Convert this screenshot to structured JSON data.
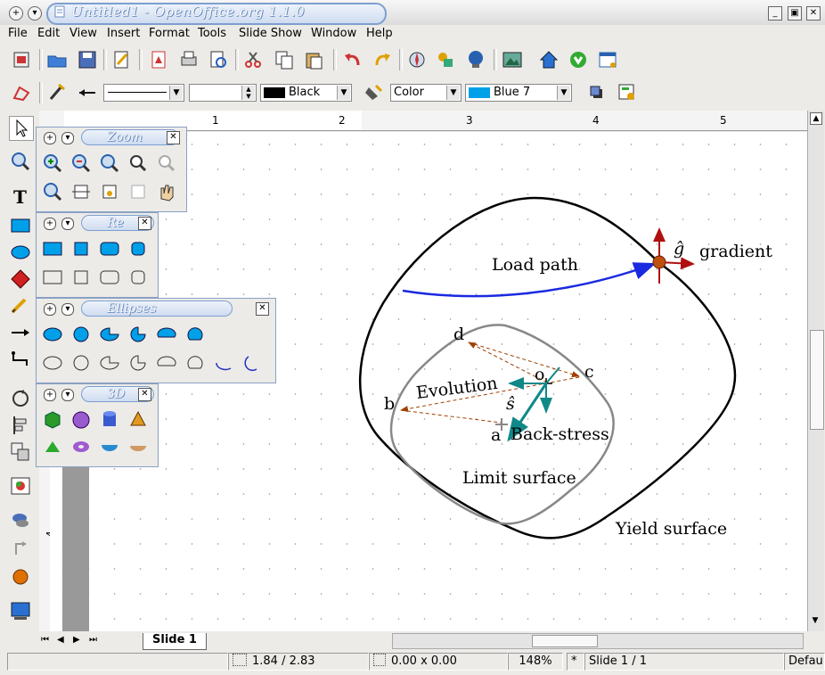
{
  "window": {
    "title": "Untitled1 - OpenOffice.org 1.1.0"
  },
  "menu": [
    "File",
    "Edit",
    "View",
    "Insert",
    "Format",
    "Tools",
    "Slide Show",
    "Window",
    "Help"
  ],
  "line_toolbar": {
    "line_style_value": "",
    "line_width_value": "",
    "line_color": "Black",
    "area_style": "Color",
    "area_color": "Blue 7",
    "colors": {
      "line": "#000000",
      "area": "#00a0e8"
    }
  },
  "ruler": {
    "h_labels": [
      "1",
      "2",
      "3",
      "4",
      "5"
    ],
    "v_labels": [
      "4"
    ]
  },
  "palettes": {
    "zoom": {
      "title": "Zoom"
    },
    "rectangles": {
      "title": "Re"
    },
    "ellipses": {
      "title": "Ellipses"
    },
    "objects_3d": {
      "title": "3D"
    }
  },
  "drawing": {
    "labels": {
      "gradient_hat": "ĝ",
      "gradient": "gradient",
      "load_path": "Load path",
      "d": "d",
      "c": "c",
      "o": "o",
      "evolution": "Evolution",
      "s_hat": "ŝ",
      "b": "b",
      "a": "a",
      "back_stress": "Back-stress",
      "limit_surface": "Limit surface",
      "yield_surface": "Yield surface"
    }
  },
  "tabs": {
    "active": "Slide 1"
  },
  "status": {
    "position": "1.84 / 2.83",
    "size": "0.00 x 0.00",
    "zoom": "148%",
    "modified": "*",
    "slide": "Slide 1 / 1",
    "layout": "Default"
  }
}
